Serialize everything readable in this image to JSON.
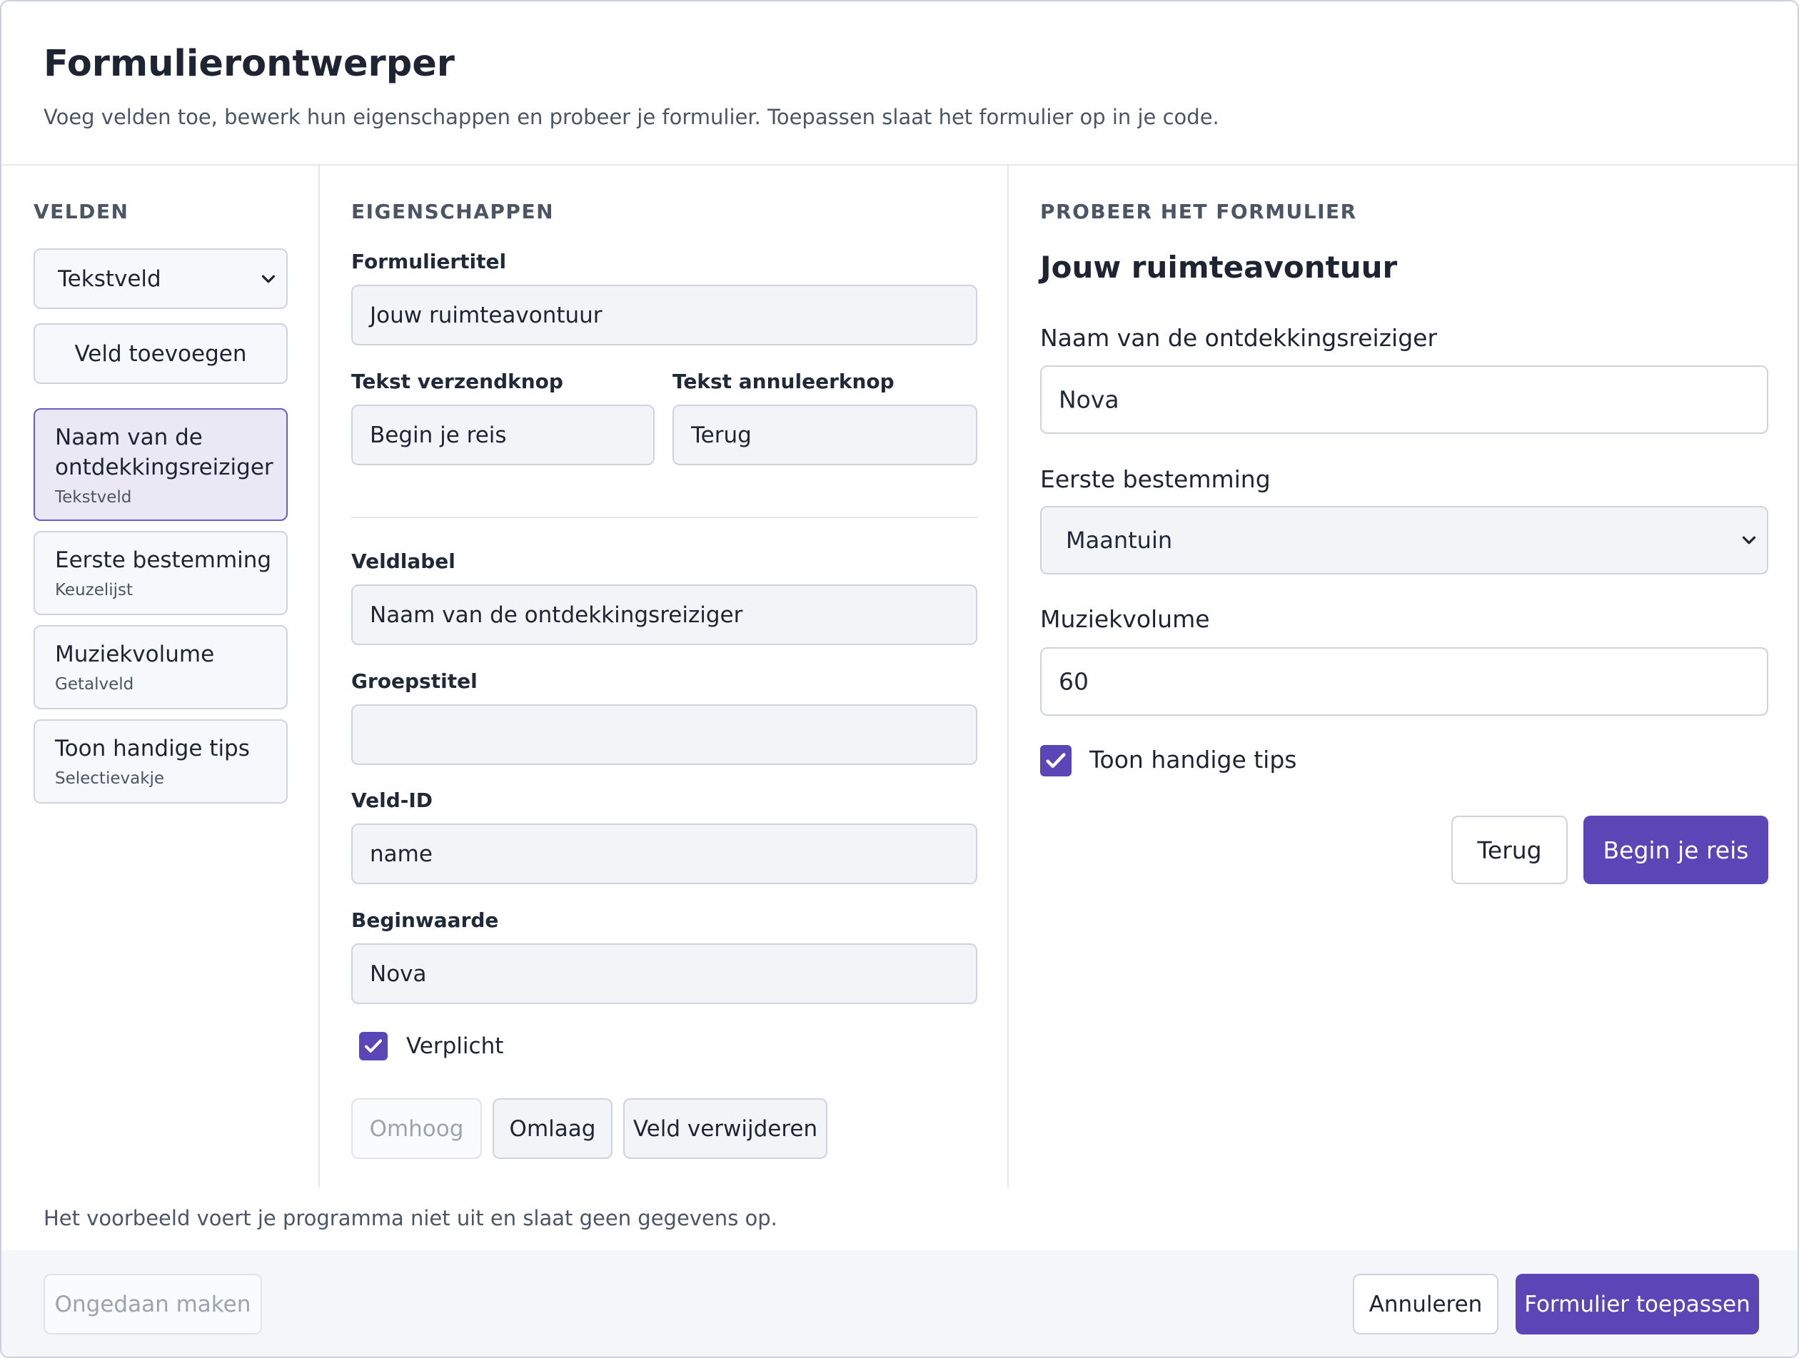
{
  "header": {
    "title": "Formulierontwerper",
    "subtitle": "Voeg velden toe, bewerk hun eigenschappen en probeer je formulier. Toepassen slaat het formulier op in je code."
  },
  "fields_panel": {
    "heading": "VELDEN",
    "type_select": "Tekstveld",
    "add_button": "Veld toevoegen",
    "items": [
      {
        "label": "Naam van de ontdekkingsreiziger",
        "type": "Tekstveld"
      },
      {
        "label": "Eerste bestemming",
        "type": "Keuzelijst"
      },
      {
        "label": "Muziekvolume",
        "type": "Getalveld"
      },
      {
        "label": "Toon handige tips",
        "type": "Selectievakje"
      }
    ]
  },
  "properties": {
    "heading": "EIGENSCHAPPEN",
    "form_title_label": "Formuliertitel",
    "form_title_value": "Jouw ruimteavontuur",
    "submit_label": "Tekst verzendknop",
    "submit_value": "Begin je reis",
    "cancel_label": "Tekst annuleerknop",
    "cancel_value": "Terug",
    "field_label_label": "Veldlabel",
    "field_label_value": "Naam van de ontdekkingsreiziger",
    "group_title_label": "Groepstitel",
    "group_title_value": "",
    "field_id_label": "Veld-ID",
    "field_id_value": "name",
    "initial_value_label": "Beginwaarde",
    "initial_value_value": "Nova",
    "required_label": "Verplicht",
    "required_checked": true,
    "up_button": "Omhoog",
    "down_button": "Omlaag",
    "delete_button": "Veld verwijderen"
  },
  "preview": {
    "heading": "PROBEER HET FORMULIER",
    "form_title": "Jouw ruimteavontuur",
    "name_label": "Naam van de ontdekkingsreiziger",
    "name_value": "Nova",
    "destination_label": "Eerste bestemming",
    "destination_value": "Maantuin",
    "volume_label": "Muziekvolume",
    "volume_value": "60",
    "tips_label": "Toon handige tips",
    "tips_checked": true,
    "cancel_button": "Terug",
    "submit_button": "Begin je reis"
  },
  "footer": {
    "note": "Het voorbeeld voert je programma niet uit en slaat geen gegevens op.",
    "undo_button": "Ongedaan maken",
    "cancel_button": "Annuleren",
    "apply_button": "Formulier toepassen"
  },
  "colors": {
    "accent": "#5b46b8",
    "selected_bg": "#ebe8f6",
    "border": "#cfd3dc"
  }
}
